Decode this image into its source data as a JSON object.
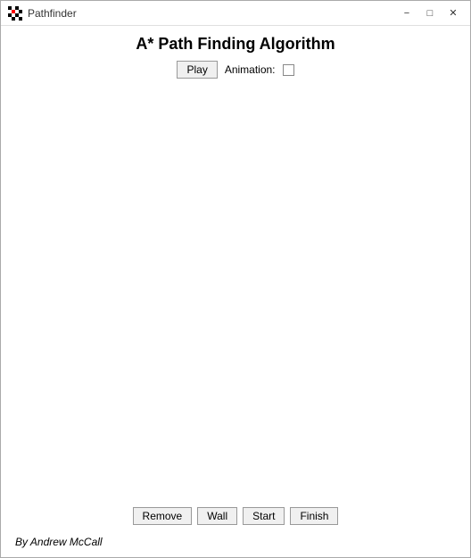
{
  "titlebar": {
    "icon": "pathfinder-icon",
    "title": "Pathfinder",
    "minimize": "−",
    "maximize": "□",
    "close": "✕"
  },
  "header": {
    "app_title": "A* Path Finding Algorithm"
  },
  "controls": {
    "play_label": "Play",
    "animation_label": "Animation:",
    "animation_checked": false
  },
  "bottom_buttons": {
    "remove_label": "Remove",
    "wall_label": "Wall",
    "start_label": "Start",
    "finish_label": "Finish"
  },
  "footer": {
    "author": "By Andrew McCall"
  }
}
